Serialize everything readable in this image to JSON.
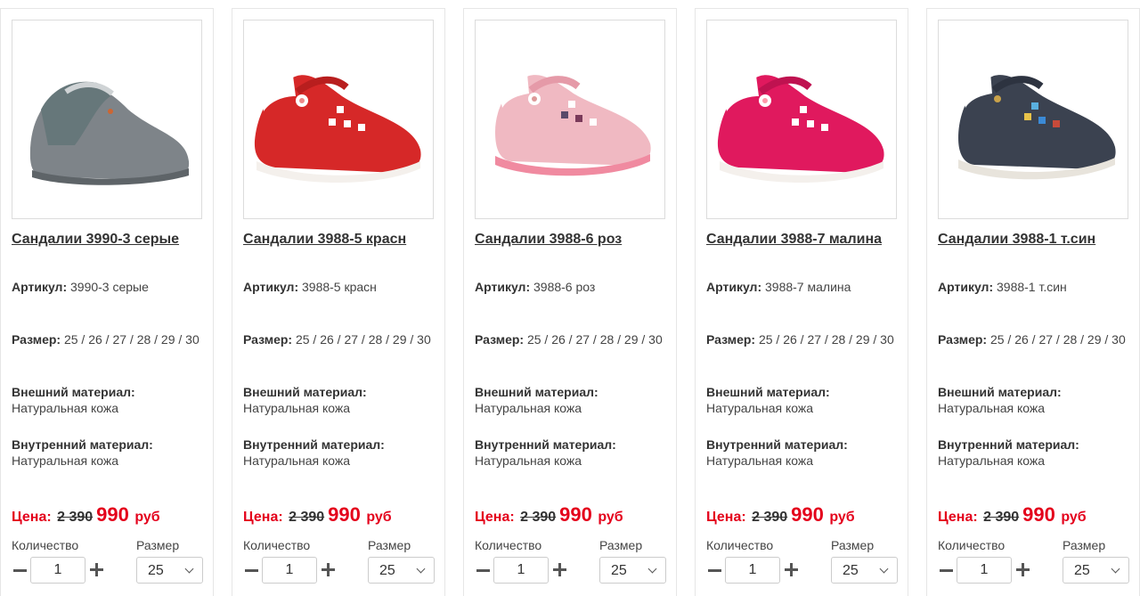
{
  "labels": {
    "article": "Артикул:",
    "size": "Размер:",
    "outer_material": "Внешний материал:",
    "inner_material": "Внутренний материал:",
    "price": "Цена:",
    "quantity": "Количество",
    "size_select": "Размер"
  },
  "colors": {
    "price": "#e4001b"
  },
  "products": [
    {
      "title": "Сандалии 3990-3 серые",
      "image_icon": "grey-sandal-image",
      "article": "3990-3 серые",
      "sizes": "25 / 26 / 27 / 28 / 29 / 30",
      "outer_material": "Натуральная кожа",
      "inner_material": "Натуральная кожа",
      "old_price": "2 390",
      "new_price": "990",
      "currency": "руб",
      "quantity": "1",
      "selected_size": "25"
    },
    {
      "title": "Сандалии 3988-5 красн",
      "image_icon": "red-sandal-image",
      "article": "3988-5 красн",
      "sizes": "25 / 26 / 27 / 28 / 29 / 30",
      "outer_material": "Натуральная кожа",
      "inner_material": "Натуральная кожа",
      "old_price": "2 390",
      "new_price": "990",
      "currency": "руб",
      "quantity": "1",
      "selected_size": "25"
    },
    {
      "title": "Сандалии 3988-6 роз",
      "image_icon": "pink-sandal-image",
      "article": "3988-6 роз",
      "sizes": "25 / 26 / 27 / 28 / 29 / 30",
      "outer_material": "Натуральная кожа",
      "inner_material": "Натуральная кожа",
      "old_price": "2 390",
      "new_price": "990",
      "currency": "руб",
      "quantity": "1",
      "selected_size": "25"
    },
    {
      "title": "Сандалии 3988-7 малина",
      "image_icon": "raspberry-sandal-image",
      "article": "3988-7 малина",
      "sizes": "25 / 26 / 27 / 28 / 29 / 30",
      "outer_material": "Натуральная кожа",
      "inner_material": "Натуральная кожа",
      "old_price": "2 390",
      "new_price": "990",
      "currency": "руб",
      "quantity": "1",
      "selected_size": "25"
    },
    {
      "title": "Сандалии 3988-1 т.син",
      "image_icon": "navy-sandal-image",
      "article": "3988-1 т.син",
      "sizes": "25 / 26 / 27 / 28 / 29 / 30",
      "outer_material": "Натуральная кожа",
      "inner_material": "Натуральная кожа",
      "old_price": "2 390",
      "new_price": "990",
      "currency": "руб",
      "quantity": "1",
      "selected_size": "25"
    }
  ]
}
